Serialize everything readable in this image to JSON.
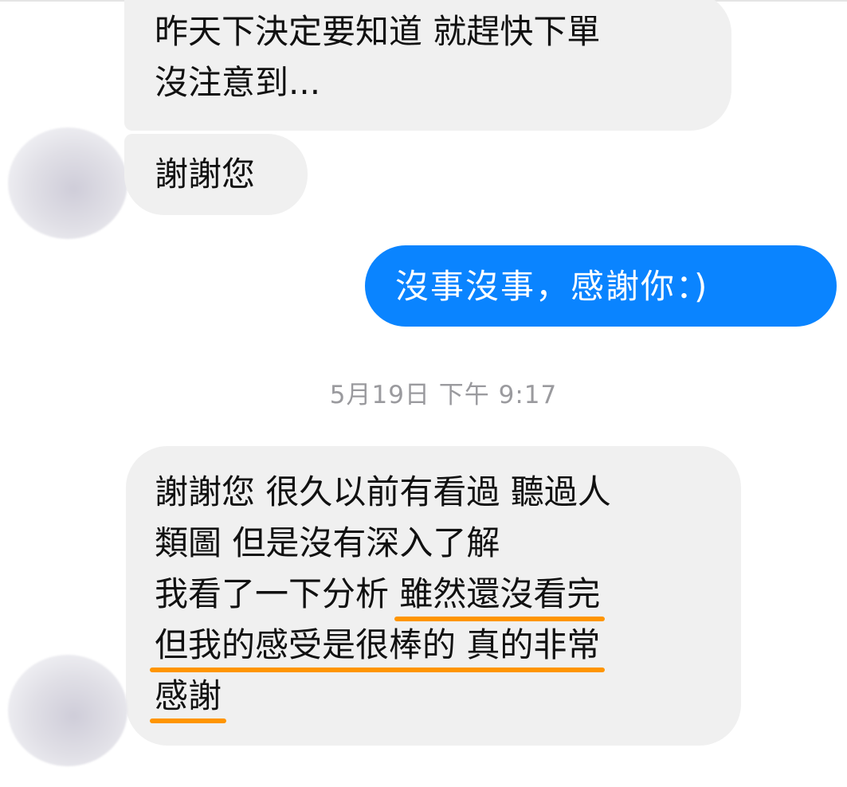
{
  "messages": [
    {
      "direction": "incoming",
      "lines": [
        "昨天下決定要知道 就趕快下單",
        "沒注意到..."
      ]
    },
    {
      "direction": "incoming",
      "lines": [
        "謝謝您"
      ]
    },
    {
      "direction": "outgoing",
      "lines": [
        "沒事沒事，感謝你：)"
      ]
    },
    {
      "direction": "incoming",
      "lines": [
        "謝謝您 很久以前有看過 聽過人",
        "類圖 但是沒有深入了解",
        "我看了一下分析 ",
        "雖然還沒看完",
        "但我的感受是很棒的 真的非常",
        "感謝"
      ]
    }
  ],
  "timestamp": "5月19日 下午 9:17",
  "colors": {
    "incoming_bubble": "#f0f0f0",
    "outgoing_bubble": "#0a84ff",
    "highlight_underline": "#ff9500",
    "timestamp_text": "#9a9a9e"
  },
  "icons": {
    "avatar": "blurred-avatar"
  }
}
